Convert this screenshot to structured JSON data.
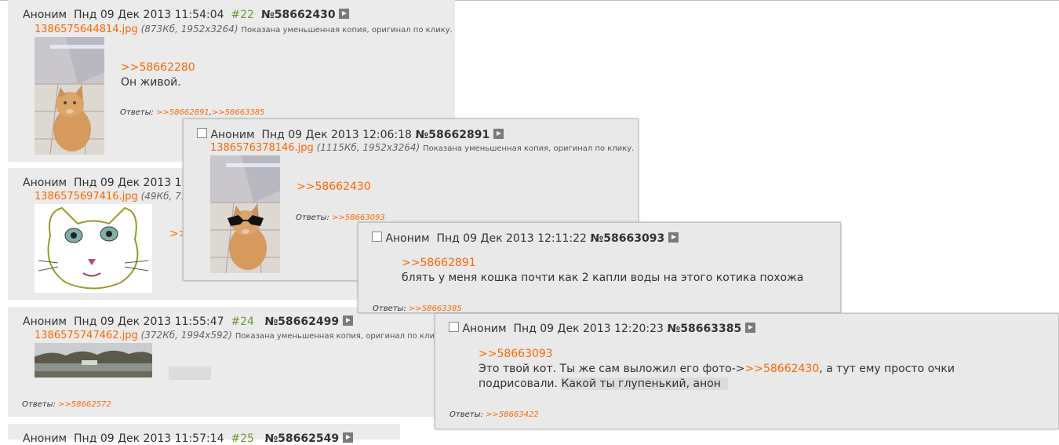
{
  "post22": {
    "author": "Аноним",
    "date": "Пнд 09 Дек 2013 11:54:04",
    "num": "#22",
    "postno": "№58662430",
    "filename": "1386575644814.jpg",
    "filemeta": "(873Кб, 1952x3264)",
    "note": "Показана уменьшенная копия, оригинал по клику.",
    "link": ">>58662280",
    "text": "Он живой.",
    "replies_label": "Ответы:",
    "replies": [
      ">>58662891",
      ">>58663385"
    ]
  },
  "post23": {
    "author": "Аноним",
    "date": "Пнд 09 Дек 2013 1",
    "filename": "1386575697416.jpg",
    "filemeta": "(49Кб, 71",
    "link_fragment": ">>"
  },
  "post24": {
    "author": "Аноним",
    "date": "Пнд 09 Дек 2013 11:55:47",
    "num": "#24",
    "postno": "№58662499",
    "filename": "1386575747462.jpg",
    "filemeta": "(372Кб, 1994x592)",
    "note": "Показана уменьшенная копия, оригинал по клику.",
    "replies_label": "Ответы:",
    "replies": [
      ">>58662572"
    ]
  },
  "post25": {
    "author": "Аноним",
    "date": "Пнд 09 Дек 2013 11:57:14",
    "num": "#25",
    "postno": "№58662549"
  },
  "popup1": {
    "author": "Аноним",
    "date": "Пнд 09 Дек 2013 12:06:18",
    "postno": "№58662891",
    "filename": "1386576378146.jpg",
    "filemeta": "(1115Кб, 1952x3264)",
    "note": "Показана уменьшенная копия, оригинал по клику.",
    "link": ">>58662430",
    "replies_label": "Ответы:",
    "replies": [
      ">>58663093"
    ]
  },
  "popup2": {
    "author": "Аноним",
    "date": "Пнд 09 Дек 2013 12:11:22",
    "postno": "№58663093",
    "link": ">>58662891",
    "text": "блять у меня кошка почти как 2 капли воды на этого котика похожа",
    "replies_label": "Ответы:",
    "replies": [
      ">>58663385"
    ]
  },
  "popup3": {
    "author": "Аноним",
    "date": "Пнд 09 Дек 2013 12:20:23",
    "postno": "№58663385",
    "link": ">>58663093",
    "text_before": "Это твой кот. Ты же сам выложил его фото->",
    "inline_link": ">>58662430",
    "text_after": ", а тут ему просто очки",
    "text_line2": "подрисовали.",
    "selected_text": "Какой ты глупенький, анон",
    "replies_label": "Ответы:",
    "replies": [
      ">>58663422"
    ]
  }
}
